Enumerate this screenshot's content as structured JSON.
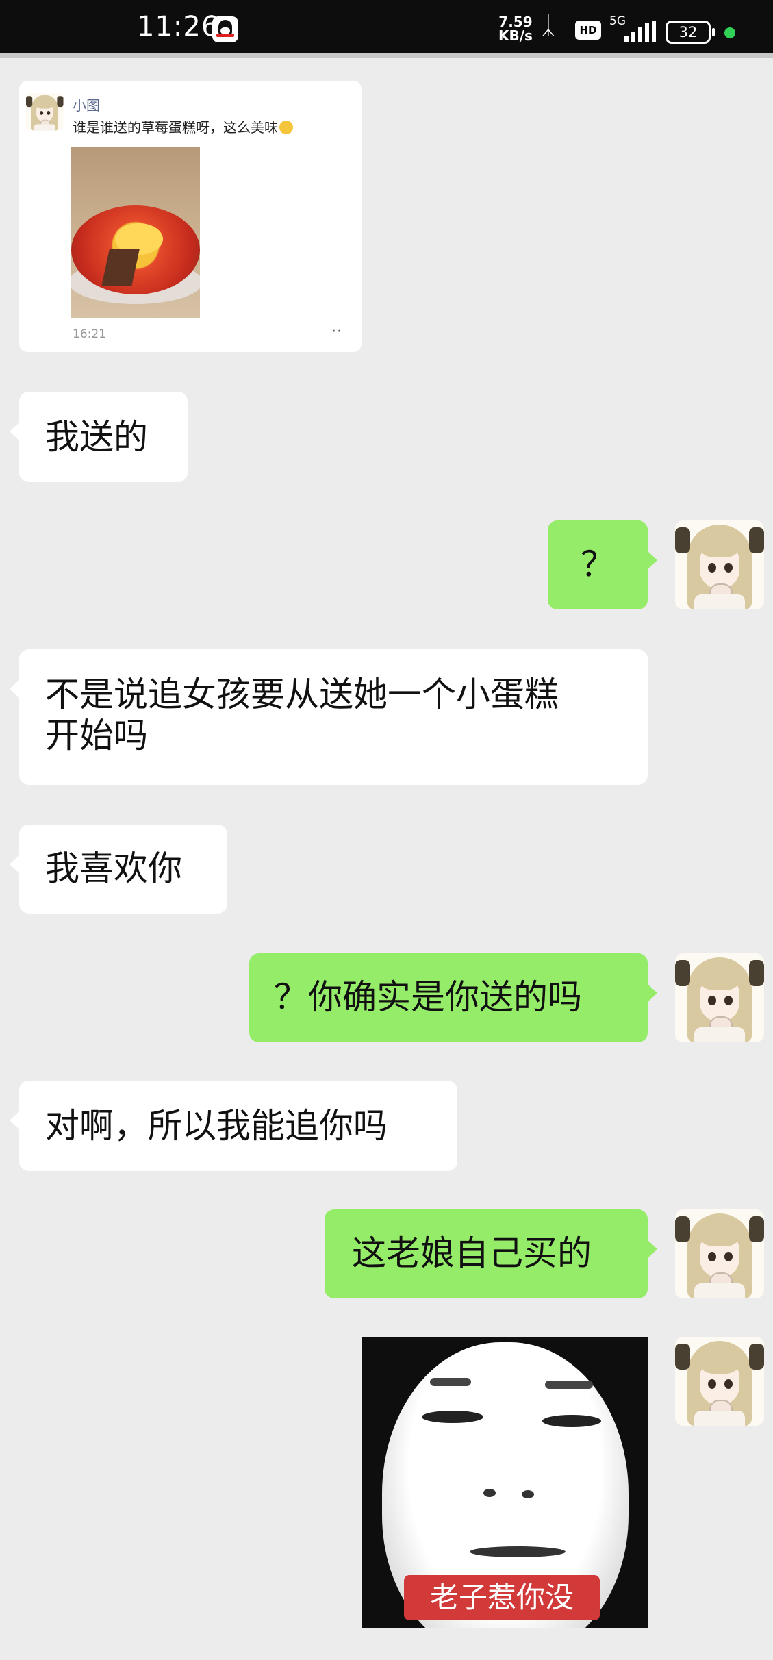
{
  "status_bar": {
    "time": "11:26",
    "net_speed": "7.59",
    "net_unit": "KB/s",
    "hd": "HD",
    "network": "5G",
    "battery": "32"
  },
  "forwarded": {
    "sender": "小图",
    "text": "谁是谁送的草莓蛋糕呀，这么美味",
    "time": "16:21",
    "more": "··"
  },
  "messages": [
    {
      "side": "left",
      "lines": [
        "我送的"
      ]
    },
    {
      "side": "right",
      "lines": [
        "？"
      ]
    },
    {
      "side": "left",
      "lines": [
        "不是说追女孩要从送她一个小蛋糕",
        "开始吗"
      ]
    },
    {
      "side": "left",
      "lines": [
        "我喜欢你"
      ]
    },
    {
      "side": "right",
      "lines": [
        "？你确实是你送的吗"
      ]
    },
    {
      "side": "left",
      "lines": [
        "对啊，所以我能追你吗"
      ]
    },
    {
      "side": "right",
      "lines": [
        "这老娘自己买的"
      ]
    }
  ],
  "sticker": {
    "caption": "老子惹你没"
  },
  "colors": {
    "outgoing_bubble": "#95ec69",
    "incoming_bubble": "#ffffff",
    "background": "#ececec"
  }
}
